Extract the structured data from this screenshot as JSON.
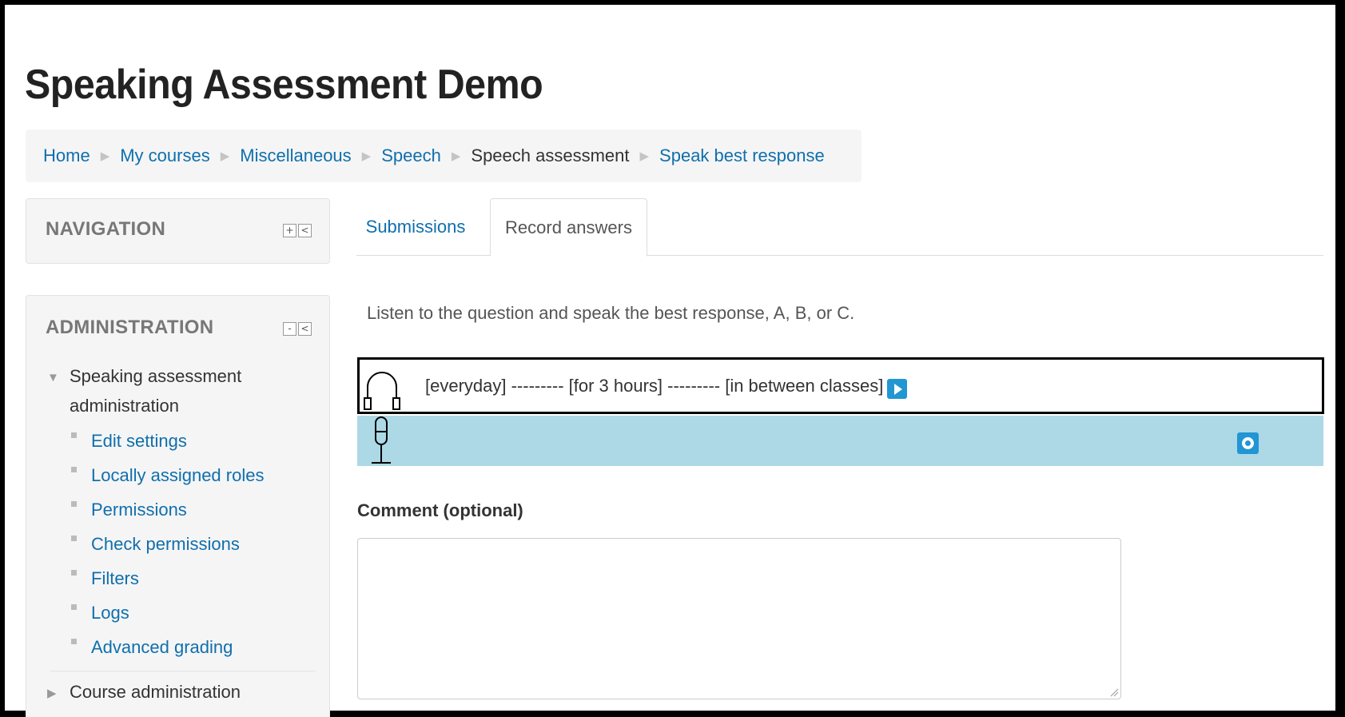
{
  "page": {
    "title": "Speaking Assessment Demo"
  },
  "breadcrumb": [
    {
      "label": "Home",
      "link": true
    },
    {
      "label": "My courses",
      "link": true
    },
    {
      "label": "Miscellaneous",
      "link": true
    },
    {
      "label": "Speech",
      "link": true
    },
    {
      "label": "Speech assessment",
      "link": false
    },
    {
      "label": "Speak best response",
      "link": true
    }
  ],
  "navigation_block": {
    "title": "NAVIGATION",
    "controls": [
      "+",
      "<"
    ]
  },
  "administration_block": {
    "title": "ADMINISTRATION",
    "controls": [
      "-",
      "<"
    ],
    "section_label": "Speaking assessment administration",
    "items": [
      {
        "label": "Edit settings"
      },
      {
        "label": "Locally assigned roles"
      },
      {
        "label": "Permissions"
      },
      {
        "label": "Check permissions"
      },
      {
        "label": "Filters"
      },
      {
        "label": "Logs"
      },
      {
        "label": "Advanced grading"
      }
    ],
    "course_admin_label": "Course administration"
  },
  "tabs": [
    {
      "label": "Submissions",
      "active": false
    },
    {
      "label": "Record answers",
      "active": true
    }
  ],
  "main": {
    "instructions": "Listen to the question and speak the best response, A, B, or C.",
    "prompt_text": "[everyday] --------- [for 3 hours] --------- [in between classes]",
    "comment_label": "Comment (optional)",
    "comment_value": ""
  },
  "colors": {
    "link": "#0f6fad",
    "accent_button": "#2196d3",
    "recorder_bg": "#add8e6",
    "block_bg": "#f5f5f5"
  },
  "icons": {
    "player": "headphones-icon",
    "recorder": "microphone-icon",
    "play": "play-icon",
    "record": "record-icon"
  }
}
